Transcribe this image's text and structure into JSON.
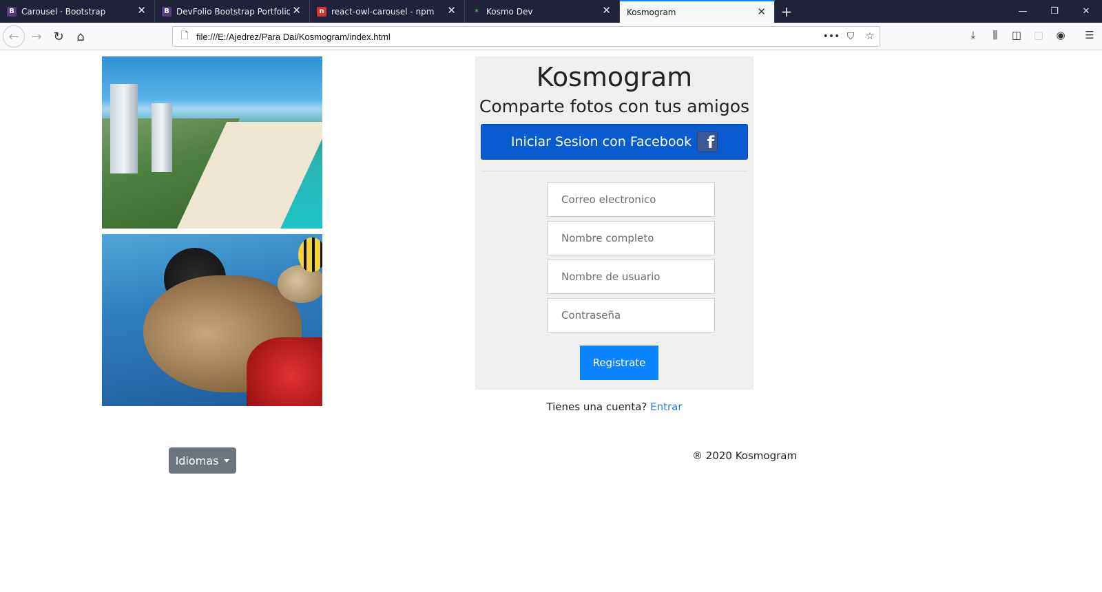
{
  "browser": {
    "tabs": [
      {
        "title": "Carousel · Bootstrap",
        "favicon": "B",
        "favicon_color": "#563d7c"
      },
      {
        "title": "DevFolio Bootstrap Portfolio Te",
        "favicon": "B",
        "favicon_color": "#563d7c"
      },
      {
        "title": "react-owl-carousel - npm",
        "favicon": "n",
        "favicon_color": "#cb3837"
      },
      {
        "title": "Kosmo Dev",
        "favicon": "✶",
        "favicon_color": "#2e7d32"
      },
      {
        "title": "Kosmogram",
        "favicon": "",
        "favicon_color": ""
      }
    ],
    "active_tab": 4,
    "url": "file:///E:/Ajedrez/Para Dai/Kosmogram/index.html"
  },
  "page": {
    "brand": "Kosmogram",
    "tagline": "Comparte fotos con tus amigos",
    "facebook_button": "Iniciar Sesion con Facebook",
    "facebook_logo": "f",
    "fields": {
      "email_placeholder": "Correo electronico",
      "fullname_placeholder": "Nombre completo",
      "username_placeholder": "Nombre de usuario",
      "password_placeholder": "Contraseña"
    },
    "register_button": "Registrate",
    "have_account": "Tienes una cuenta?",
    "login_link": "Entrar",
    "language_button": "Idiomas",
    "copyright": "® 2020 Kosmogram"
  },
  "colors": {
    "facebook_blue": "#0a5bd0",
    "primary": "#0a84ff",
    "secondary": "#6c757d"
  }
}
